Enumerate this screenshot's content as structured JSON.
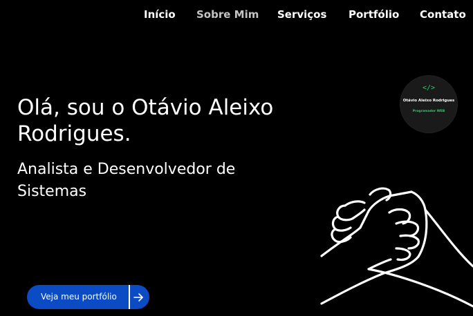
{
  "nav": {
    "items": [
      {
        "label": "Início",
        "active": false
      },
      {
        "label": "Sobre Mim",
        "active": true
      },
      {
        "label": "Serviços",
        "active": false
      },
      {
        "label": "Portfólio",
        "active": false
      },
      {
        "label": "Contato",
        "active": false
      }
    ]
  },
  "hero": {
    "title": "Olá, sou o Otávio Aleixo Rodrigues.",
    "subtitle": "Analista e Desenvolvedor de Sistemas",
    "cta_label": "Veja meu portfólio",
    "cta_icon": "arrow-right-icon"
  },
  "badge": {
    "icon": "code-icon",
    "icon_glyph": "</>",
    "name": "Otávio Aleixo Rodrigues",
    "role": "Programador WEB"
  },
  "illustration": {
    "icon": "handshake-icon"
  },
  "colors": {
    "background": "#000000",
    "text": "#ffffff",
    "nav_active": "#c4c4c4",
    "accent_green": "#2ecc71",
    "cta_blue": "#0b4cc4"
  }
}
